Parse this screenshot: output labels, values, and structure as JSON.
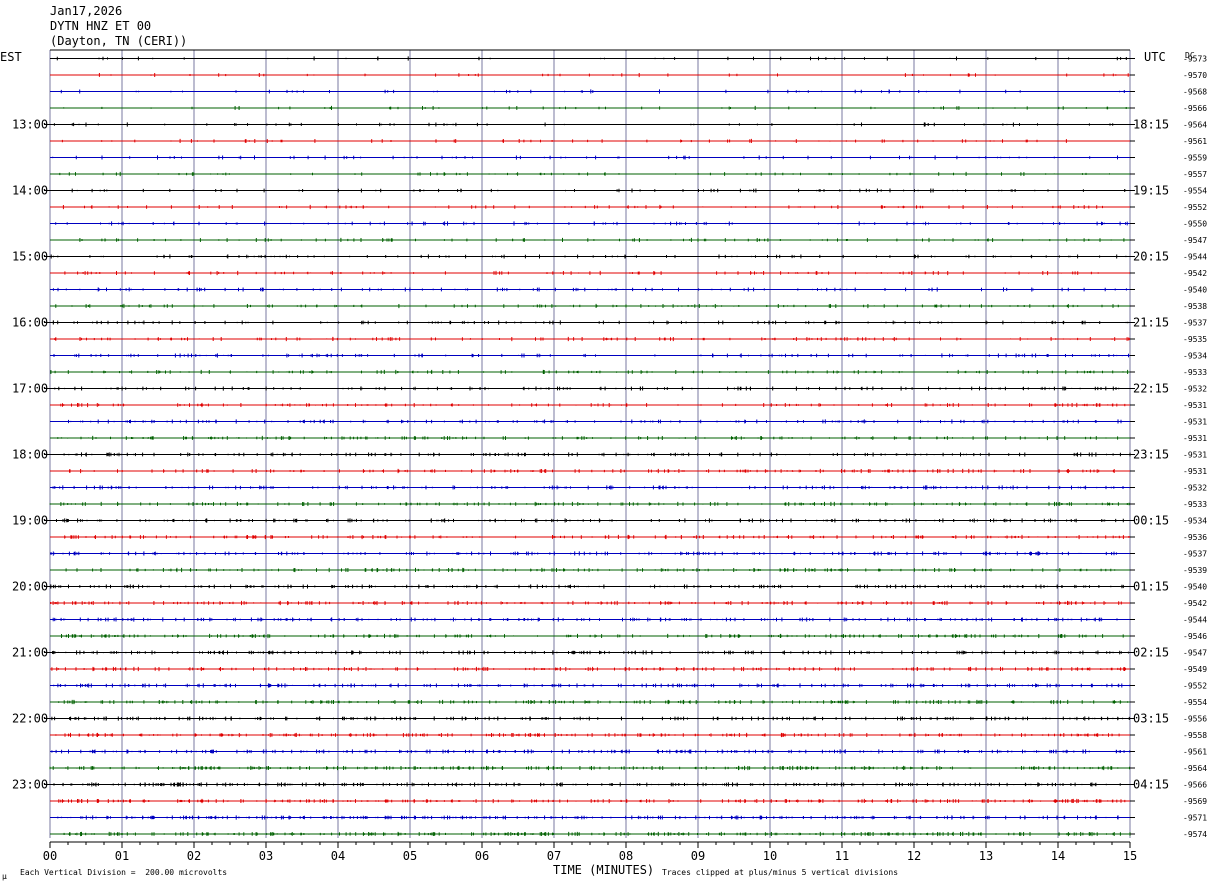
{
  "header": {
    "date": "Jan17,2026",
    "station": "DYTN HNZ ET 00",
    "location": "(Dayton, TN (CERI))"
  },
  "left_timezone": "EST",
  "right_timezone": "UTC",
  "dc_label": "DC",
  "footer": {
    "scale": "Each Vertical Division =  200.00 microvolts",
    "clip_note": "Traces clipped at plus/minus 5 vertical divisions",
    "mark": "μ"
  },
  "colors": {
    "black": "#000000",
    "red": "#e00000",
    "blue": "#0000c0",
    "green": "#006000",
    "grid": "#7878a0"
  },
  "chart_data": {
    "type": "line",
    "title": "DYTN HNZ ET 00",
    "xlabel": "TIME (MINUTES)",
    "xlim": [
      0,
      15
    ],
    "x_ticks": [
      "00",
      "01",
      "02",
      "03",
      "04",
      "05",
      "06",
      "07",
      "08",
      "09",
      "10",
      "11",
      "12",
      "13",
      "14",
      "15"
    ],
    "trace_colors_cycle": [
      "black",
      "red",
      "blue",
      "green"
    ],
    "est_labels": [
      "13:00",
      "14:00",
      "15:00",
      "16:00",
      "17:00",
      "18:00",
      "19:00",
      "20:00",
      "21:00",
      "22:00",
      "23:00"
    ],
    "utc_labels": [
      "18:15",
      "19:15",
      "20:15",
      "21:15",
      "22:15",
      "23:15",
      "00:15",
      "01:15",
      "02:15",
      "03:15",
      "04:15"
    ],
    "dc_offsets": [
      "-9573",
      "-9570",
      "-9568",
      "-9566",
      "-9564",
      "-9561",
      "-9559",
      "-9557",
      "-9554",
      "-9552",
      "-9550",
      "-9547",
      "-9544",
      "-9542",
      "-9540",
      "-9538",
      "-9537",
      "-9535",
      "-9534",
      "-9533",
      "-9532",
      "-9531",
      "-9531",
      "-9531",
      "-9531",
      "-9531",
      "-9532",
      "-9533",
      "-9534",
      "-9536",
      "-9537",
      "-9539",
      "-9540",
      "-9542",
      "-9544",
      "-9546",
      "-9547",
      "-9549",
      "-9552",
      "-9554",
      "-9556",
      "-9558",
      "-9561",
      "-9564",
      "-9566",
      "-9569",
      "-9571",
      "-9574"
    ]
  }
}
